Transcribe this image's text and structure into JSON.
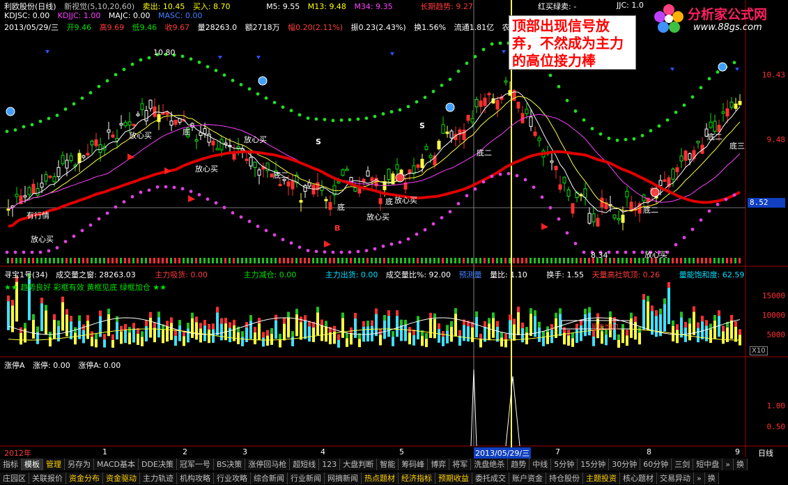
{
  "header": {
    "stock_name": "利欧股份(日线)",
    "indicator": "新视觉(5,10,20,60)",
    "sell_label": "卖出: 10.45",
    "buy_label": "买入: 8.70",
    "ma": [
      "M5: 9.55",
      "M13: 9.48",
      "M34: 9.35"
    ],
    "long_trend": "长期趋势: 9.27",
    "red_buy_green_sell": "红买绿卖: -",
    "jjc": "JJC: 1.0",
    "kdjsc": "KDJSC: 0.00",
    "kdjjc": "KDJJC: 1.00",
    "majc": "MAJC: 0.00",
    "masc": "MASC: 0.00",
    "date_line": "2013/05/29/三",
    "open": "开9.46",
    "high": "高9.69",
    "low": "低9.46",
    "close": "收9.67",
    "volume": "量28263.0",
    "amount": "额2718万",
    "change": "幅0.20(2.11%)",
    "amplitude": "振0.23(2.43%)",
    "turnover": "换1.56%",
    "float_cap": "流通1.81亿",
    "industry": "农用机械"
  },
  "callout": "顶部出现信号放弃，不然成为主力的高位接力棒",
  "logo": {
    "title": "分析家公式网",
    "url": "www.88gs.com"
  },
  "price_axis": [
    "10.43",
    "9.48",
    "8.52"
  ],
  "price_marks": {
    "peak": "10.80",
    "fangxin": "放心买",
    "di": "底",
    "di2": "底二",
    "di3": "底三",
    "youhangqing": "有行情",
    "low_val": "8.34",
    "s": "S",
    "b": "B"
  },
  "panel2": {
    "title": "寻宝1号(34)",
    "vol_window": "成交量之窗: 28263.03",
    "main_absorb": "主力吸货: 0.00",
    "main_reduce": "主力减仓: 0.00",
    "main_out": "主力出货: 0.00",
    "vol_ratio": "成交量比%: 92.00",
    "predict": "预测量",
    "liangbi": "量比: 1.10",
    "turn": "换手: 1.55",
    "tianliang": "天量高社筑顶: 0.26",
    "saturation": "量能饱和度: 62.59",
    "slogan": "★★ 趋势良好 彩框有效  黄框见底 绿框加仓 ★★",
    "axis": [
      "15000",
      "10000",
      "5000",
      "X10"
    ],
    "box_label": "量能饱和"
  },
  "panel3": {
    "title": "涨停A",
    "v1": "涨停: 0.00",
    "v2": "涨停A: 0.00",
    "axis": [
      "1.00",
      "0.50"
    ]
  },
  "time_axis": {
    "year": "2012年",
    "months": [
      "1",
      "2",
      "3",
      "4",
      "5",
      "6",
      "7",
      "8",
      "9"
    ],
    "cursor_date": "2013/05/29/三",
    "period": "日线"
  },
  "tabs_row1": [
    "指标",
    "模板",
    "管理",
    "另存为",
    "MACD基本",
    "DDE决策",
    "冠军一号",
    "BS决策",
    "涨停回马枪",
    "超短线",
    "123",
    "大盘判断",
    "智能",
    "筹码峰",
    "博弈",
    "将军",
    "洗盘绝杀",
    "趋势",
    "中线",
    "5分钟",
    "15分钟",
    "30分钟",
    "60分钟",
    "三剑",
    "短中盘",
    "»",
    "换"
  ],
  "tabs_row2": [
    "庄园区",
    "关联报价",
    "资金分布",
    "资金驱动",
    "主力轨迹",
    "机构攻略",
    "行业攻略",
    "综合新闻",
    "行业新闻",
    "网摘新闻",
    "热点题材",
    "经济指标",
    "预期收益",
    "委托成交",
    "账户资金",
    "持仓股份",
    "主题投资",
    "核心题材",
    "交易异动",
    "»",
    "换"
  ],
  "colors": {
    "up": "#ff3c3c",
    "down": "#00ffff",
    "trend_red": "#e00000",
    "dots_green": "#20e020",
    "dots_magenta": "#e040e0",
    "cursor": "#ffff60"
  }
}
